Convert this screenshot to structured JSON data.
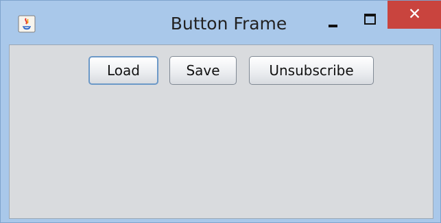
{
  "window": {
    "title": "Button Frame",
    "close_label": "✕"
  },
  "icons": {
    "app": "java-icon",
    "minimize": "minimize-icon",
    "maximize": "maximize-icon",
    "close": "close-icon"
  },
  "buttons": {
    "load": "Load",
    "save": "Save",
    "unsubscribe": "Unsubscribe"
  },
  "colors": {
    "titlebar": "#a9c8ea",
    "close": "#c9443e",
    "content": "#d9dbde",
    "focus_border": "#6b98c7"
  }
}
